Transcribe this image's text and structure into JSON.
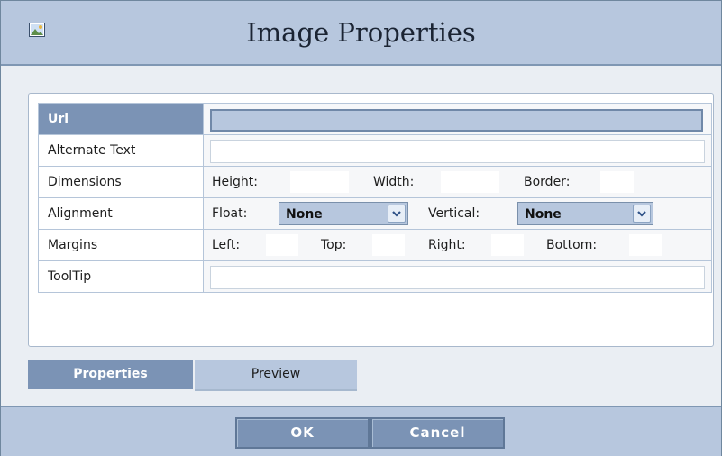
{
  "dialog": {
    "title": "Image Properties",
    "icon": "image-icon"
  },
  "rows": {
    "url": {
      "label": "Url",
      "value": ""
    },
    "alt": {
      "label": "Alternate Text",
      "value": ""
    },
    "dimensions": {
      "label": "Dimensions",
      "height_label": "Height:",
      "width_label": "Width:",
      "border_label": "Border:"
    },
    "alignment": {
      "label": "Alignment",
      "float_label": "Float:",
      "float_value": "None",
      "vertical_label": "Vertical:",
      "vertical_value": "None"
    },
    "margins": {
      "label": "Margins",
      "left_label": "Left:",
      "top_label": "Top:",
      "right_label": "Right:",
      "bottom_label": "Bottom:"
    },
    "tooltip": {
      "label": "ToolTip",
      "value": ""
    }
  },
  "tabs": {
    "properties": "Properties",
    "preview": "Preview"
  },
  "buttons": {
    "ok": "OK",
    "cancel": "Cancel"
  },
  "colors": {
    "accent": "#7b93b5",
    "header": "#b7c7de"
  }
}
